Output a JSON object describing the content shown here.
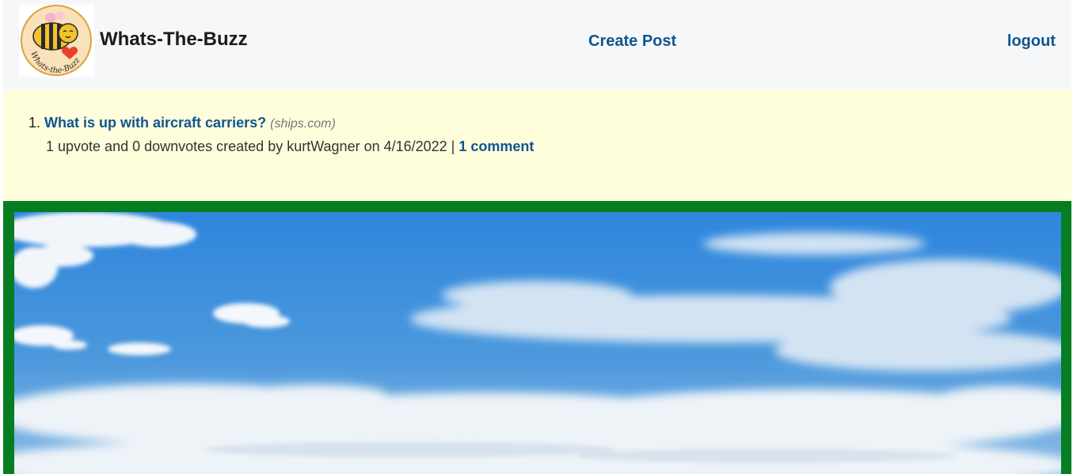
{
  "header": {
    "site_title": "Whats-The-Buzz",
    "logo_text": "Whats-the-Buzz",
    "nav": {
      "create_post": "Create Post",
      "logout": "logout"
    }
  },
  "posts": [
    {
      "number": "1.",
      "title": "What is up with aircraft carriers?",
      "domain": "(ships.com)",
      "meta_prefix": "1 upvote and 0 downvotes created by kurtWagner on 4/16/2022 |",
      "comments_label": "1 comment"
    }
  ],
  "colors": {
    "header_bg": "#f6f7f9",
    "link": "#10558f",
    "posts_bg": "#fefedd",
    "media_border": "#077d22",
    "sky": "#3d8fd9"
  },
  "icons": {
    "logo": "bee-logo-icon"
  }
}
